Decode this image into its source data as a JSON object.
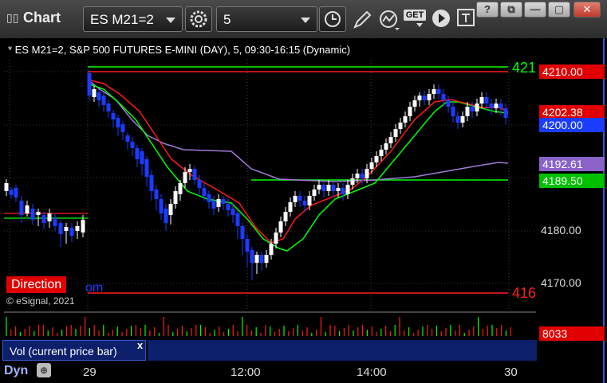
{
  "window": {
    "title": "Chart",
    "controls": {
      "help": "?",
      "restore": "⧉",
      "minimize": "—",
      "maximize": "▢",
      "close": "✕"
    }
  },
  "toolbar": {
    "symbol": "ES M21=2",
    "interval": "5",
    "get_label": "GET"
  },
  "chart": {
    "info": "* ES M21=2, S&P 500 FUTURES E-MINI (DAY), 5, 09:30-16:15 (Dynamic)",
    "copyright": "© eSignal, 2021",
    "direction_label": "Direction",
    "direction_tail": "om",
    "edge_label_top": "421",
    "edge_label_bottom": "416",
    "price_tags": {
      "p4210": "4210.00",
      "p4202": "4202.38",
      "p4200": "4200.00",
      "p4192": "4192.61",
      "p4189": "4189.50"
    },
    "axis_labels": {
      "a4180": "4180.00",
      "a4170": "4170.00"
    },
    "time_labels": {
      "t29": "29",
      "t1200": "12:00",
      "t1400": "14:00",
      "t30": "30"
    },
    "colors": {
      "up": "#ffffff",
      "down": "#1a3cff",
      "red_line": "#ff1a1a",
      "green_line": "#00ff00",
      "purple_line": "#a07ad8",
      "tag_red": "#e00000",
      "tag_blue": "#1a3cff",
      "tag_purple": "#8a63c9",
      "tag_green": "#00c000"
    }
  },
  "volume": {
    "label": "Vol (current price bar)",
    "close": "x",
    "value": "8033"
  },
  "bottom": {
    "dyn_label": "Dyn"
  }
}
